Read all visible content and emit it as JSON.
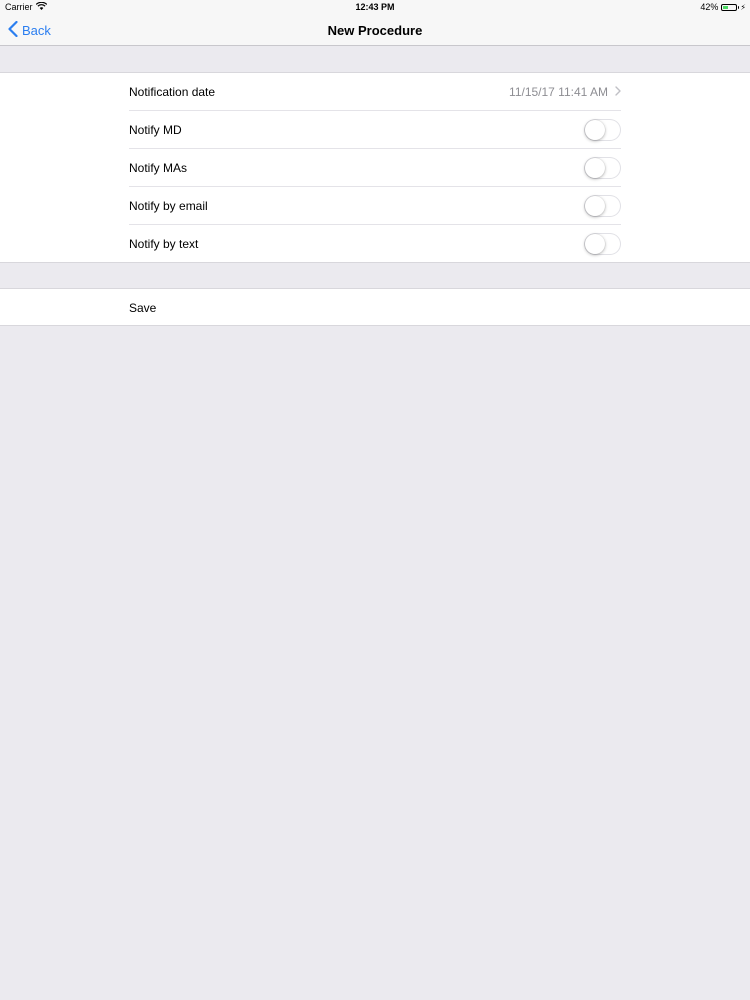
{
  "status_bar": {
    "carrier": "Carrier",
    "time": "12:43 PM",
    "battery_percent": "42%",
    "battery_level": 0.42,
    "icons": [
      "wifi-icon",
      "battery-icon",
      "charging-bolt-icon"
    ]
  },
  "nav": {
    "back_label": "Back",
    "title": "New Procedure",
    "accent_color": "#2b7ef0"
  },
  "settings": {
    "notification_date": {
      "label": "Notification date",
      "value": "11/15/17 11:41 AM"
    },
    "toggles": [
      {
        "label": "Notify MD",
        "on": false
      },
      {
        "label": "Notify MAs",
        "on": false
      },
      {
        "label": "Notify by email",
        "on": false
      },
      {
        "label": "Notify by text",
        "on": false
      }
    ]
  },
  "actions": {
    "save_label": "Save"
  }
}
